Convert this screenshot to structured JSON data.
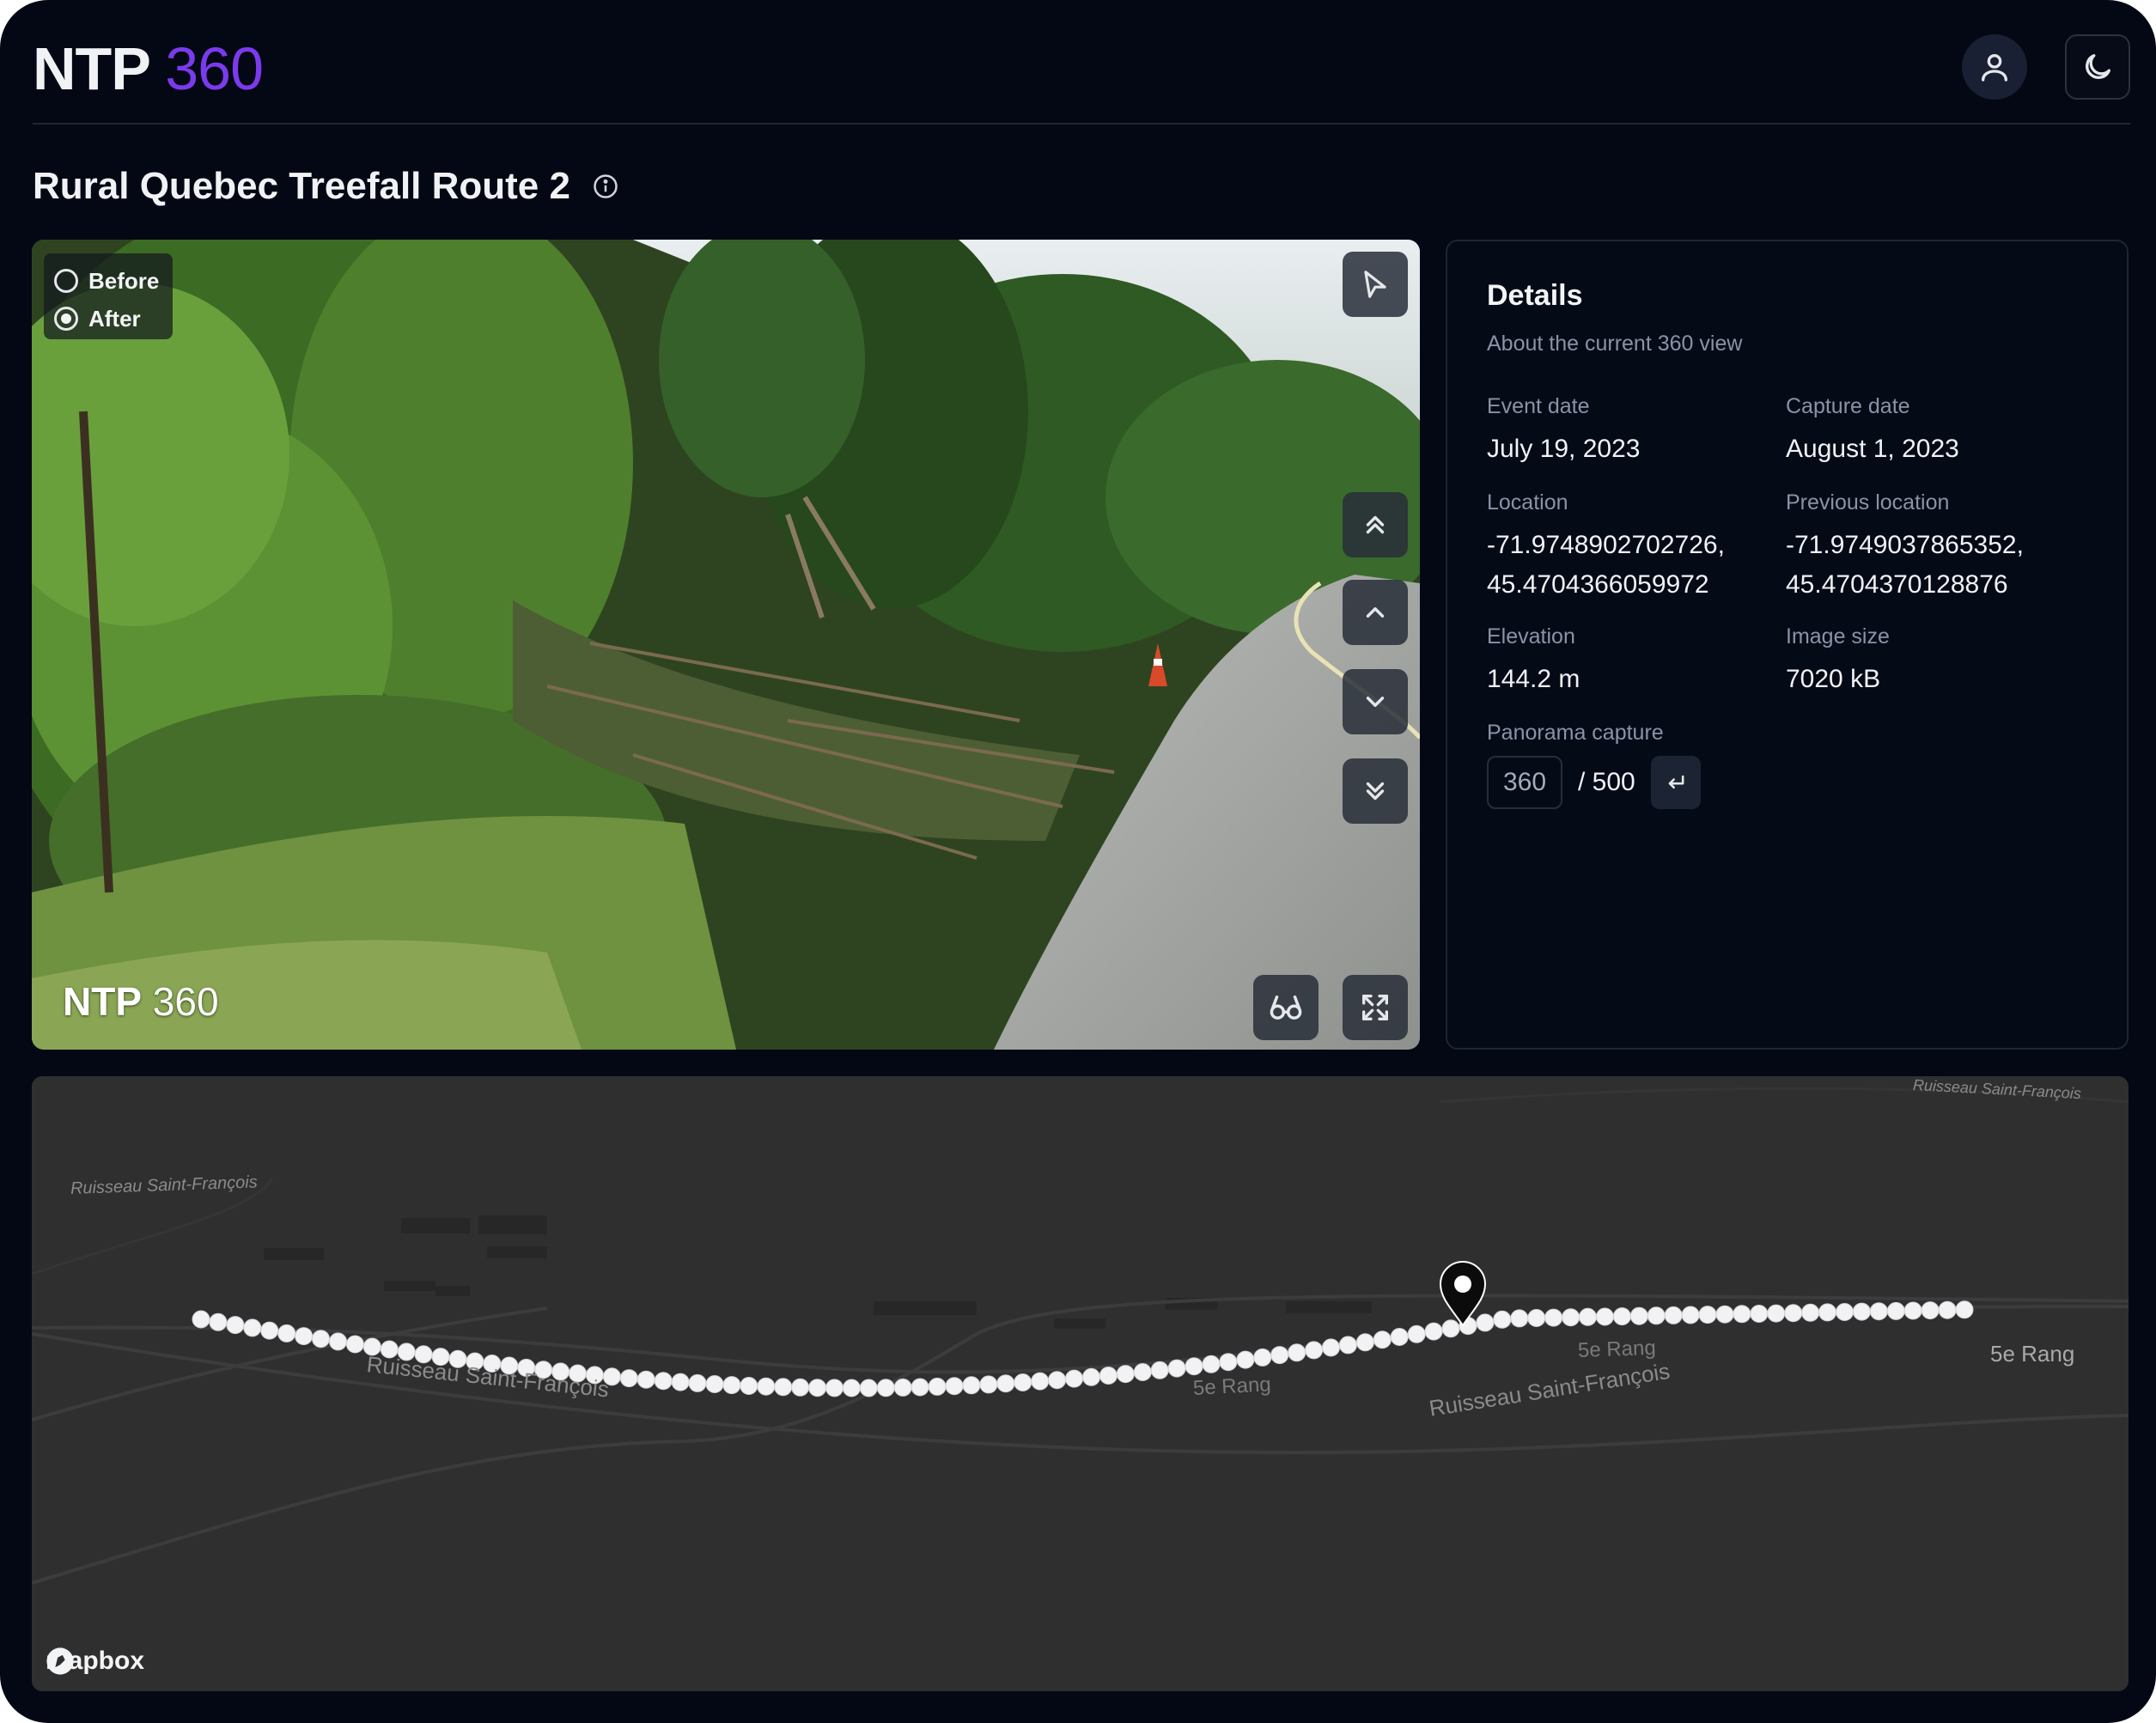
{
  "header": {
    "logo_part1": "NTP",
    "logo_part2": "360",
    "user_icon": "user-icon",
    "theme_icon": "moon-icon"
  },
  "page": {
    "title": "Rural Quebec Treefall Route 2",
    "info_icon": "info-icon"
  },
  "viewer": {
    "toggle": {
      "before_label": "Before",
      "after_label": "After",
      "selected": "After"
    },
    "watermark_part1": "NTP",
    "watermark_part2": "360",
    "controls": [
      "cursor-icon",
      "double-chevron-up-icon",
      "chevron-up-icon",
      "chevron-down-icon",
      "double-chevron-down-icon",
      "glasses-icon",
      "fullscreen-icon"
    ]
  },
  "details": {
    "title": "Details",
    "subtitle": "About the current 360 view",
    "event_date_label": "Event date",
    "event_date_value": "July 19, 2023",
    "capture_date_label": "Capture date",
    "capture_date_value": "August 1, 2023",
    "location_label": "Location",
    "location_line1": "-71.9748902702726,",
    "location_line2": "45.4704366059972",
    "previous_location_label": "Previous location",
    "previous_location_line1": "-71.9749037865352,",
    "previous_location_line2": "45.4704370128876",
    "elevation_label": "Elevation",
    "elevation_value": "144.2 m",
    "image_size_label": "Image size",
    "image_size_value": "7020 kB",
    "panorama_label": "Panorama capture",
    "panorama_current": "360",
    "panorama_total": "/ 500"
  },
  "map": {
    "labels": {
      "stream_top_left": "Ruisseau Saint-François",
      "stream_top_right": "Ruisseau Saint-François",
      "stream_mid_left": "Ruisseau Saint-François",
      "stream_mid_right": "Ruisseau Saint-François",
      "road_1": "5e Rang",
      "road_2": "5e Rang",
      "road_3": "5e Rang"
    },
    "attribution": "mapbox",
    "track_point_count": 104,
    "marker_icon": "map-pin-icon"
  }
}
